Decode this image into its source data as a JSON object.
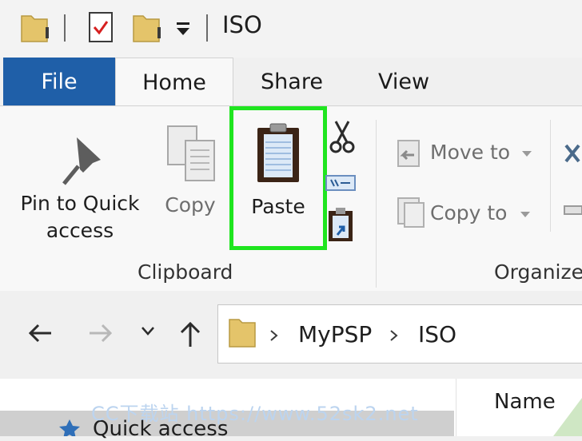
{
  "window": {
    "title": "ISO"
  },
  "tabs": {
    "file": "File",
    "home": "Home",
    "share": "Share",
    "view": "View"
  },
  "ribbon": {
    "pin_label_line1": "Pin to Quick",
    "pin_label_line2": "access",
    "copy_label": "Copy",
    "paste_label": "Paste",
    "clipboard_group": "Clipboard",
    "move_to": "Move to",
    "copy_to": "Copy to",
    "organize_group": "Organize"
  },
  "nav": {
    "breadcrumb": [
      "MyPSP",
      "ISO"
    ]
  },
  "list": {
    "column_name": "Name",
    "quick_access": "Quick access"
  },
  "overlay": {
    "watermark": "CC下载站 https://www.52sk2.net"
  },
  "colors": {
    "file_tab": "#1f5fa8",
    "highlight": "#1fe51f",
    "folder": "#e4c46a"
  },
  "icons": [
    "folder-icon",
    "properties-icon",
    "new-folder-icon",
    "dropdown-icon",
    "pin-icon",
    "copy-icon",
    "paste-icon",
    "cut-icon",
    "copy-path-icon",
    "paste-shortcut-icon",
    "move-to-icon",
    "copy-to-icon",
    "back-arrow-icon",
    "forward-arrow-icon",
    "recent-chevron-icon",
    "up-arrow-icon",
    "star-icon"
  ]
}
